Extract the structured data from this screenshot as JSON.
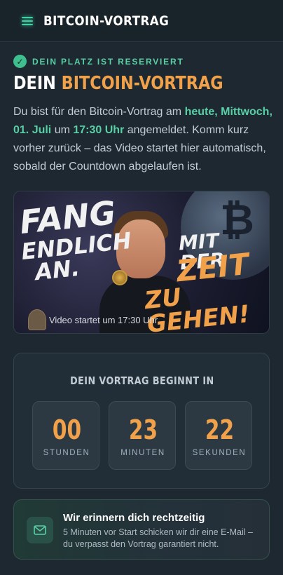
{
  "header": {
    "menu_icon": "hamburger-menu-icon",
    "brand": "BITCOIN-VORTRAG"
  },
  "status": {
    "icon": "check-circle-icon",
    "text": "DEIN PLATZ IST RESERVIERT"
  },
  "title": {
    "prefix": "DEIN ",
    "accent": "BITCOIN-VORTRAG"
  },
  "intro": {
    "part1": "Du bist für den Bitcoin-Vortrag am ",
    "date": "heute, Mittwoch, 01. Juli",
    "part2": " um ",
    "time": "17:30 Uhr",
    "part3": " angemeldet. Komm kurz vorher zurück – das Video startet hier automatisch, sobald der Countdown abgelaufen ist."
  },
  "video": {
    "overlay_line1": "FANG",
    "overlay_line2": "ENDLICH",
    "overlay_line3": "AN.",
    "overlay_line4": "MIT DER",
    "overlay_line5": "ZEIT",
    "overlay_line6": "ZU GEHEN!",
    "caption": "Video startet um 17:30 Uhr"
  },
  "countdown": {
    "title": "DEIN VORTRAG BEGINNT IN",
    "units": [
      {
        "value": "00",
        "label": "STUNDEN"
      },
      {
        "value": "23",
        "label": "MINUTEN"
      },
      {
        "value": "22",
        "label": "SEKUNDEN"
      }
    ]
  },
  "reminder": {
    "icon": "mail-icon",
    "title": "Wir erinnern dich rechtzeitig",
    "text": "5 Minuten vor Start schicken wir dir eine E-Mail – du verpasst den Vortrag garantiert nicht."
  },
  "colors": {
    "accent_orange": "#f0a14a",
    "accent_green": "#59cfa6",
    "background": "#1d2830"
  }
}
